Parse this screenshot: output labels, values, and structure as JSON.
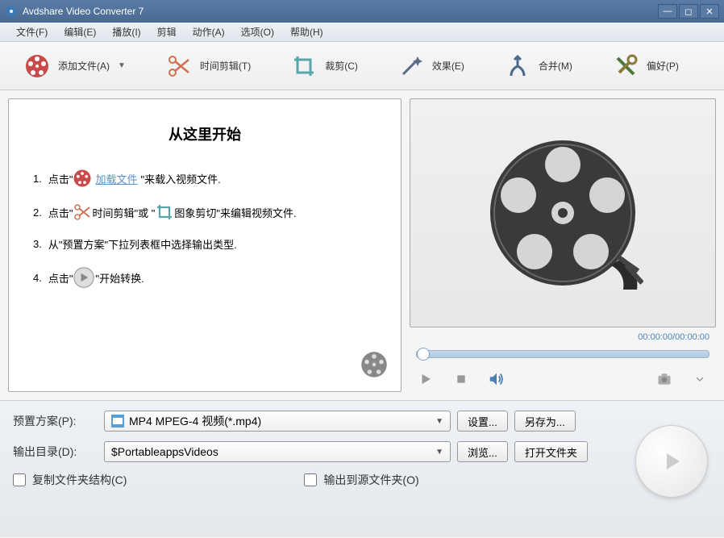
{
  "titlebar": {
    "title": "Avdshare Video Converter 7"
  },
  "menu": [
    {
      "label": "文件(F)"
    },
    {
      "label": "编辑(E)"
    },
    {
      "label": "播放(I)"
    },
    {
      "label": "剪辑"
    },
    {
      "label": "动作(A)"
    },
    {
      "label": "选项(O)"
    },
    {
      "label": "帮助(H)"
    }
  ],
  "toolbar": {
    "add_file": "添加文件(A)",
    "time_trim": "时间剪辑(T)",
    "crop": "裁剪(C)",
    "effect": "效果(E)",
    "merge": "合并(M)",
    "prefs": "偏好(P)"
  },
  "start": {
    "title": "从这里开始",
    "step1_a": "点击\"",
    "step1_link": "加载文件",
    "step1_b": "\"来载入视频文件.",
    "step2_a": "点击\"",
    "step2_time": "时间剪辑",
    "step2_or": "\"或 \"",
    "step2_crop": "图象剪切",
    "step2_b": "\"来编辑视频文件.",
    "step3": "从\"预置方案\"下拉列表框中选择输出类型.",
    "step4_a": "点击\"",
    "step4_b": "\"开始转换."
  },
  "player": {
    "time_current": "00:00:00",
    "time_separator": " / ",
    "time_total": "00:00:00"
  },
  "bottom": {
    "preset_label": "预置方案(P):",
    "preset_value": "MP4 MPEG-4 视频(*.mp4)",
    "settings_btn": "设置...",
    "saveas_btn": "另存为...",
    "output_label": "输出目录(D):",
    "output_value": "$PortableappsVideos",
    "browse_btn": "浏览...",
    "openfolder_btn": "打开文件夹",
    "copy_structure": "复制文件夹结构(C)",
    "output_source": "输出到源文件夹(O)"
  }
}
